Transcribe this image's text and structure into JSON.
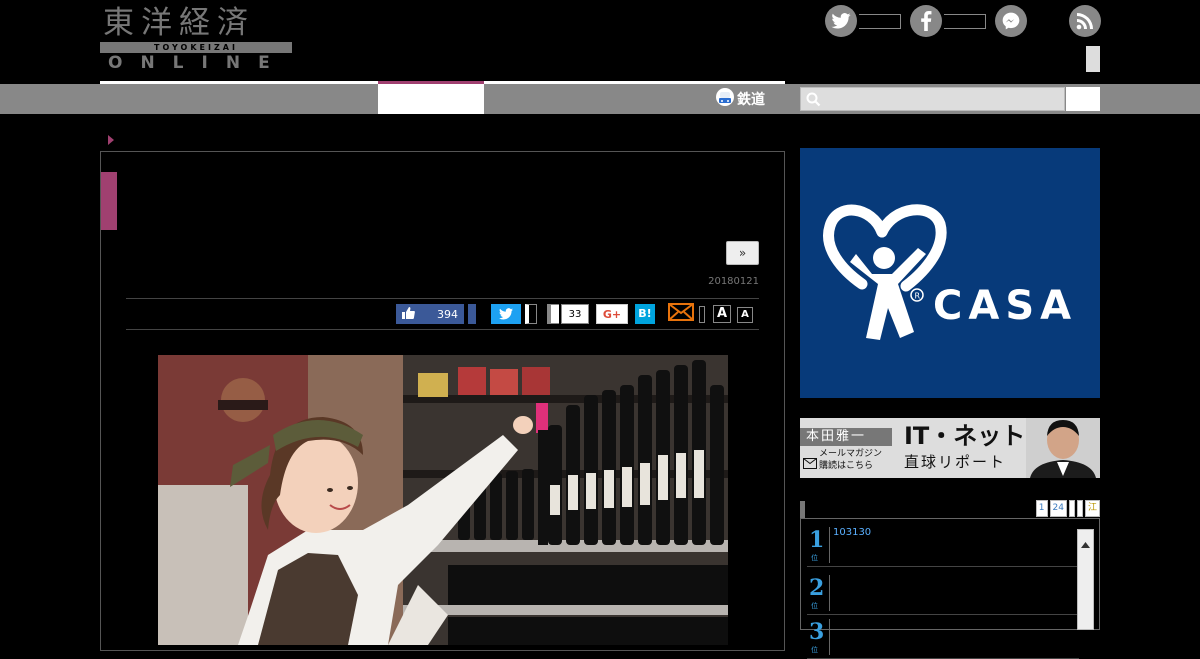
{
  "header": {
    "logo_kanji": "東洋経済",
    "logo_roman": "TOYOKEIZAI",
    "logo_online": "ONLINE"
  },
  "nav": {
    "rail_label": "鉄道",
    "search_placeholder": ""
  },
  "article": {
    "next_label": "»",
    "date": "20180121",
    "share": {
      "facebook_count": "394",
      "hatena_count": "33",
      "gplus_label": "G+",
      "hatena_label": "B!",
      "font_large": "A",
      "font_small": "A"
    }
  },
  "sidebar": {
    "ad_brand": "CASA",
    "mail_banner": {
      "author": "本田雅一",
      "title": "IT・ネット",
      "subtitle": "直球リポート",
      "line1": "メールマガジン",
      "line2": "購読はこちら"
    },
    "ranking": {
      "tabs": [
        "1",
        "24",
        "",
        "",
        "江"
      ],
      "items": [
        {
          "rank": "1",
          "text": "103130"
        },
        {
          "rank": "2",
          "text": ""
        },
        {
          "rank": "3",
          "text": ""
        }
      ],
      "rank_suffix": "位"
    }
  },
  "colors": {
    "accent": "#a04070",
    "nav": "#888888",
    "casa_bg": "#073a7a",
    "facebook": "#3b5998",
    "twitter": "#1da1f2",
    "hatena": "#00a4de"
  }
}
